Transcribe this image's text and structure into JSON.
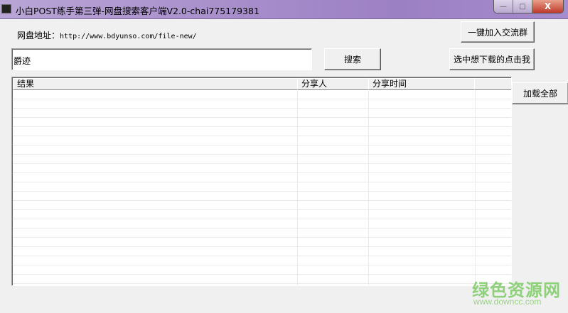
{
  "window": {
    "title": "小白POST练手第三弹-网盘搜索客户端V2.0-chai775179381",
    "minimize": "—",
    "maximize": "□",
    "close": "X"
  },
  "address": {
    "label": "网盘地址：",
    "url": "http://www.bdyunso.com/file-new/"
  },
  "search": {
    "value": "爵迹",
    "button": "搜索"
  },
  "buttons": {
    "join_group": "一键加入交流群",
    "download_selected": "选中想下载的点击我",
    "load_all": "加载全部"
  },
  "table": {
    "columns": [
      "结果",
      "分享人",
      "分享时间",
      ""
    ]
  },
  "watermark": {
    "name": "绿色资源网",
    "url": "www.downcc.com"
  }
}
